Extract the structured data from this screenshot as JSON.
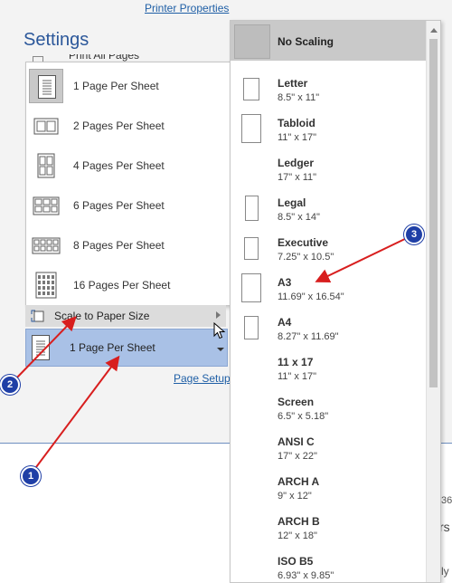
{
  "header": {
    "printer_properties": "Printer Properties",
    "settings_title": "Settings",
    "partial_item": "Print All Pages"
  },
  "pages_per_sheet_menu": {
    "items": [
      {
        "label": "1 Page Per Sheet",
        "selected": true
      },
      {
        "label": "2 Pages Per Sheet"
      },
      {
        "label": "4 Pages Per Sheet"
      },
      {
        "label": "6 Pages Per Sheet"
      },
      {
        "label": "8 Pages Per Sheet"
      },
      {
        "label": "16 Pages Per Sheet"
      }
    ],
    "scale_to_paper_size": "Scale to Paper Size"
  },
  "pages_dropdown": {
    "value": "1 Page Per Sheet"
  },
  "page_setup_link": "Page Setup",
  "scaling_menu": {
    "no_scaling": "No Scaling",
    "sizes": [
      {
        "name": "Letter",
        "dims": "8.5\" x 11\""
      },
      {
        "name": "Tabloid",
        "dims": "11\" x 17\""
      },
      {
        "name": "Ledger",
        "dims": "17\" x 11\""
      },
      {
        "name": "Legal",
        "dims": "8.5\" x 14\""
      },
      {
        "name": "Executive",
        "dims": "7.25\" x 10.5\""
      },
      {
        "name": "A3",
        "dims": "11.69\" x 16.54\""
      },
      {
        "name": "A4",
        "dims": "8.27\" x 11.69\""
      },
      {
        "name": "11 x 17",
        "dims": "11\" x 17\""
      },
      {
        "name": "Screen",
        "dims": "6.5\" x 5.18\""
      },
      {
        "name": "ANSI C",
        "dims": "17\" x 22\""
      },
      {
        "name": "ARCH A",
        "dims": "9\" x 12\""
      },
      {
        "name": "ARCH B",
        "dims": "12\" x 18\""
      },
      {
        "name": "ISO B5",
        "dims": "6.93\" x 9.85\""
      }
    ]
  },
  "background_fragments": {
    "f1": "36-",
    "f2": "rs",
    "f3": "ly"
  },
  "annotations": {
    "badge1": "1",
    "badge2": "2",
    "badge3": "3",
    "arrow_color": "#d81e1e",
    "badge_color": "#1f3fa6"
  }
}
